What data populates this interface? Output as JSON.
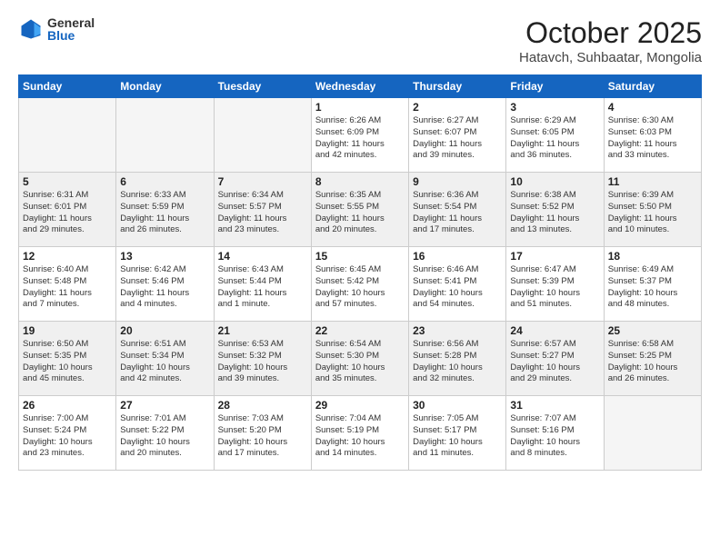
{
  "header": {
    "logo_general": "General",
    "logo_blue": "Blue",
    "month_title": "October 2025",
    "subtitle": "Hatavch, Suhbaatar, Mongolia"
  },
  "weekdays": [
    "Sunday",
    "Monday",
    "Tuesday",
    "Wednesday",
    "Thursday",
    "Friday",
    "Saturday"
  ],
  "weeks": [
    [
      {
        "day": "",
        "info": ""
      },
      {
        "day": "",
        "info": ""
      },
      {
        "day": "",
        "info": ""
      },
      {
        "day": "1",
        "info": "Sunrise: 6:26 AM\nSunset: 6:09 PM\nDaylight: 11 hours\nand 42 minutes."
      },
      {
        "day": "2",
        "info": "Sunrise: 6:27 AM\nSunset: 6:07 PM\nDaylight: 11 hours\nand 39 minutes."
      },
      {
        "day": "3",
        "info": "Sunrise: 6:29 AM\nSunset: 6:05 PM\nDaylight: 11 hours\nand 36 minutes."
      },
      {
        "day": "4",
        "info": "Sunrise: 6:30 AM\nSunset: 6:03 PM\nDaylight: 11 hours\nand 33 minutes."
      }
    ],
    [
      {
        "day": "5",
        "info": "Sunrise: 6:31 AM\nSunset: 6:01 PM\nDaylight: 11 hours\nand 29 minutes."
      },
      {
        "day": "6",
        "info": "Sunrise: 6:33 AM\nSunset: 5:59 PM\nDaylight: 11 hours\nand 26 minutes."
      },
      {
        "day": "7",
        "info": "Sunrise: 6:34 AM\nSunset: 5:57 PM\nDaylight: 11 hours\nand 23 minutes."
      },
      {
        "day": "8",
        "info": "Sunrise: 6:35 AM\nSunset: 5:55 PM\nDaylight: 11 hours\nand 20 minutes."
      },
      {
        "day": "9",
        "info": "Sunrise: 6:36 AM\nSunset: 5:54 PM\nDaylight: 11 hours\nand 17 minutes."
      },
      {
        "day": "10",
        "info": "Sunrise: 6:38 AM\nSunset: 5:52 PM\nDaylight: 11 hours\nand 13 minutes."
      },
      {
        "day": "11",
        "info": "Sunrise: 6:39 AM\nSunset: 5:50 PM\nDaylight: 11 hours\nand 10 minutes."
      }
    ],
    [
      {
        "day": "12",
        "info": "Sunrise: 6:40 AM\nSunset: 5:48 PM\nDaylight: 11 hours\nand 7 minutes."
      },
      {
        "day": "13",
        "info": "Sunrise: 6:42 AM\nSunset: 5:46 PM\nDaylight: 11 hours\nand 4 minutes."
      },
      {
        "day": "14",
        "info": "Sunrise: 6:43 AM\nSunset: 5:44 PM\nDaylight: 11 hours\nand 1 minute."
      },
      {
        "day": "15",
        "info": "Sunrise: 6:45 AM\nSunset: 5:42 PM\nDaylight: 10 hours\nand 57 minutes."
      },
      {
        "day": "16",
        "info": "Sunrise: 6:46 AM\nSunset: 5:41 PM\nDaylight: 10 hours\nand 54 minutes."
      },
      {
        "day": "17",
        "info": "Sunrise: 6:47 AM\nSunset: 5:39 PM\nDaylight: 10 hours\nand 51 minutes."
      },
      {
        "day": "18",
        "info": "Sunrise: 6:49 AM\nSunset: 5:37 PM\nDaylight: 10 hours\nand 48 minutes."
      }
    ],
    [
      {
        "day": "19",
        "info": "Sunrise: 6:50 AM\nSunset: 5:35 PM\nDaylight: 10 hours\nand 45 minutes."
      },
      {
        "day": "20",
        "info": "Sunrise: 6:51 AM\nSunset: 5:34 PM\nDaylight: 10 hours\nand 42 minutes."
      },
      {
        "day": "21",
        "info": "Sunrise: 6:53 AM\nSunset: 5:32 PM\nDaylight: 10 hours\nand 39 minutes."
      },
      {
        "day": "22",
        "info": "Sunrise: 6:54 AM\nSunset: 5:30 PM\nDaylight: 10 hours\nand 35 minutes."
      },
      {
        "day": "23",
        "info": "Sunrise: 6:56 AM\nSunset: 5:28 PM\nDaylight: 10 hours\nand 32 minutes."
      },
      {
        "day": "24",
        "info": "Sunrise: 6:57 AM\nSunset: 5:27 PM\nDaylight: 10 hours\nand 29 minutes."
      },
      {
        "day": "25",
        "info": "Sunrise: 6:58 AM\nSunset: 5:25 PM\nDaylight: 10 hours\nand 26 minutes."
      }
    ],
    [
      {
        "day": "26",
        "info": "Sunrise: 7:00 AM\nSunset: 5:24 PM\nDaylight: 10 hours\nand 23 minutes."
      },
      {
        "day": "27",
        "info": "Sunrise: 7:01 AM\nSunset: 5:22 PM\nDaylight: 10 hours\nand 20 minutes."
      },
      {
        "day": "28",
        "info": "Sunrise: 7:03 AM\nSunset: 5:20 PM\nDaylight: 10 hours\nand 17 minutes."
      },
      {
        "day": "29",
        "info": "Sunrise: 7:04 AM\nSunset: 5:19 PM\nDaylight: 10 hours\nand 14 minutes."
      },
      {
        "day": "30",
        "info": "Sunrise: 7:05 AM\nSunset: 5:17 PM\nDaylight: 10 hours\nand 11 minutes."
      },
      {
        "day": "31",
        "info": "Sunrise: 7:07 AM\nSunset: 5:16 PM\nDaylight: 10 hours\nand 8 minutes."
      },
      {
        "day": "",
        "info": ""
      }
    ]
  ]
}
